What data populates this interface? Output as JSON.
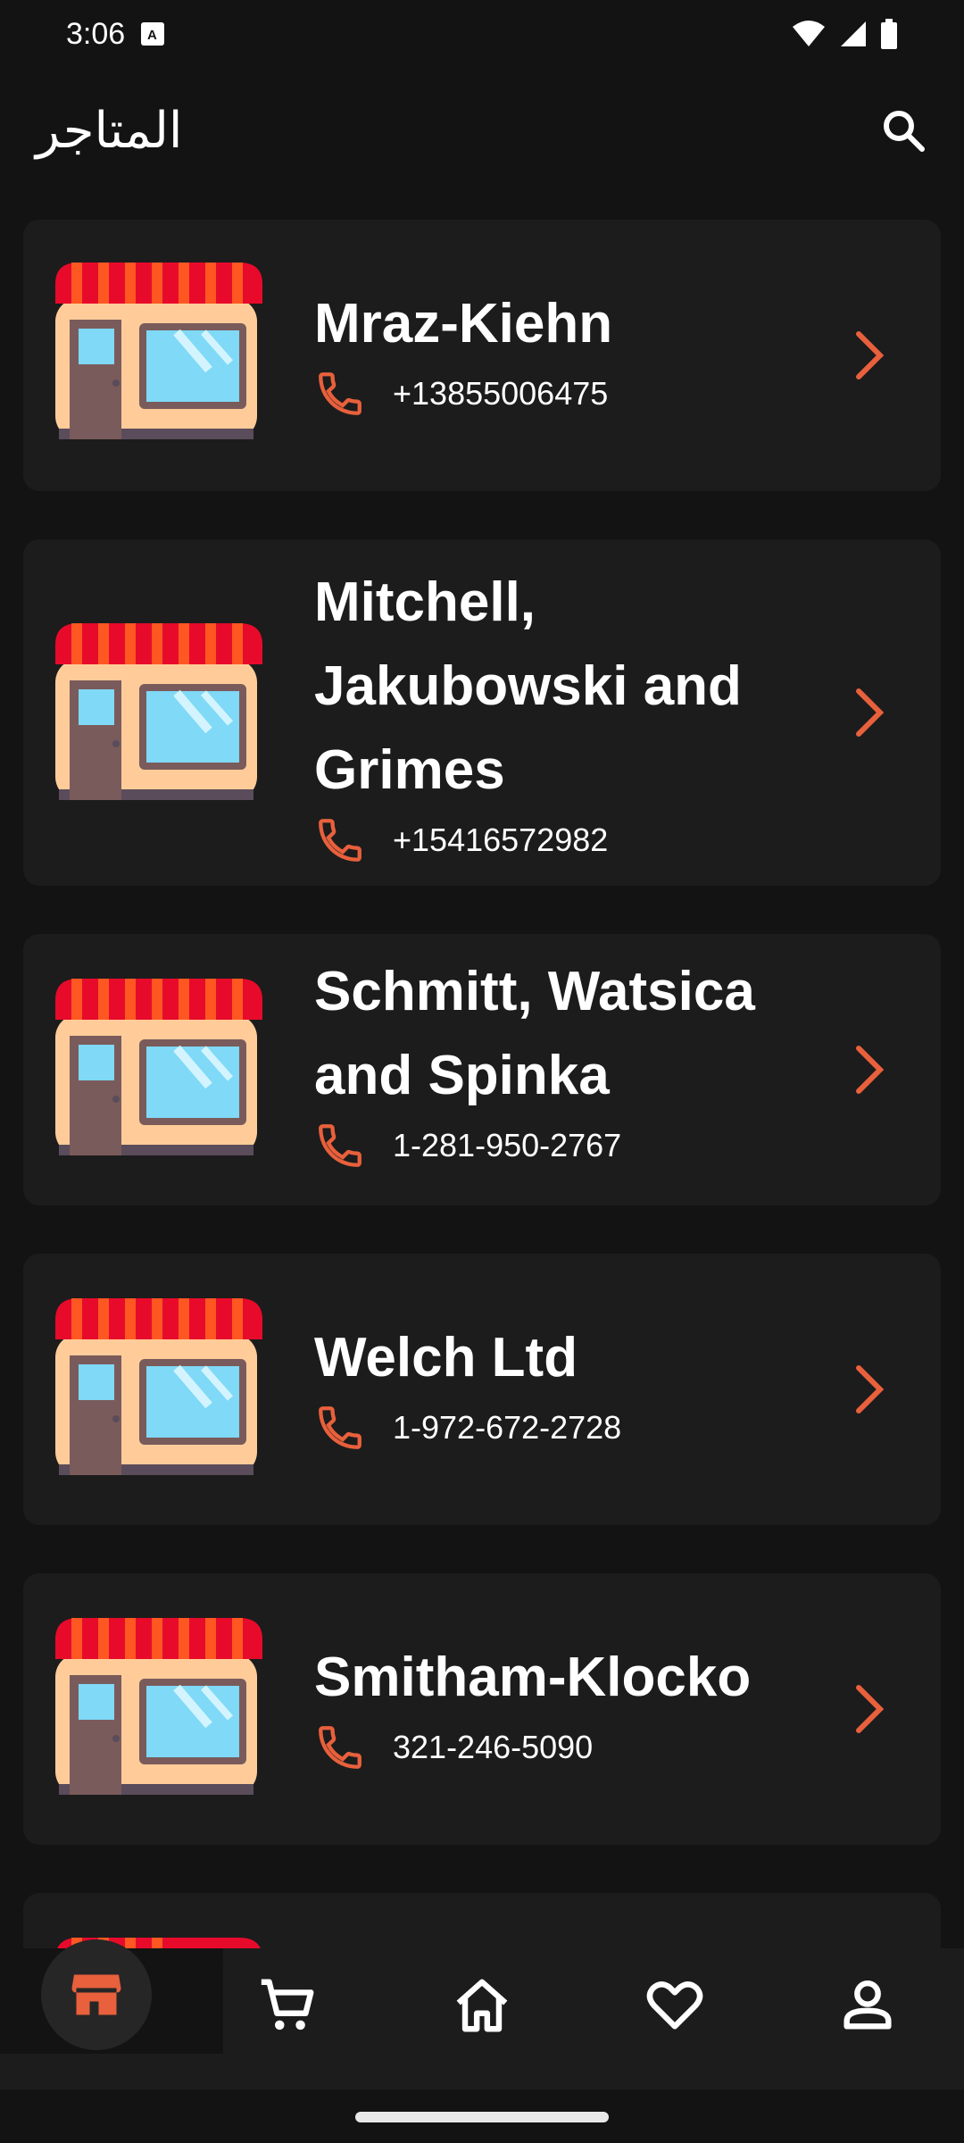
{
  "status_bar": {
    "time": "3:06"
  },
  "app_bar": {
    "title": "المتاجر"
  },
  "stores": [
    {
      "name": "Mraz-Kiehn",
      "phone": "+13855006475"
    },
    {
      "name": "Mitchell, Jakubowski and Grimes",
      "phone": "+15416572982"
    },
    {
      "name": "Schmitt, Watsica and Spinka",
      "phone": "1-281-950-2767"
    },
    {
      "name": "Welch Ltd",
      "phone": "1-972-672-2728"
    },
    {
      "name": "Smitham-Klocko",
      "phone": "321-246-5090"
    }
  ],
  "colors": {
    "accent": "#E8603C",
    "card": "#1C1C1C",
    "background": "#131313"
  },
  "bottom_nav": {
    "items": [
      "store-icon",
      "cart-icon",
      "home-icon",
      "heart-icon",
      "profile-icon"
    ],
    "active": "store-icon"
  }
}
